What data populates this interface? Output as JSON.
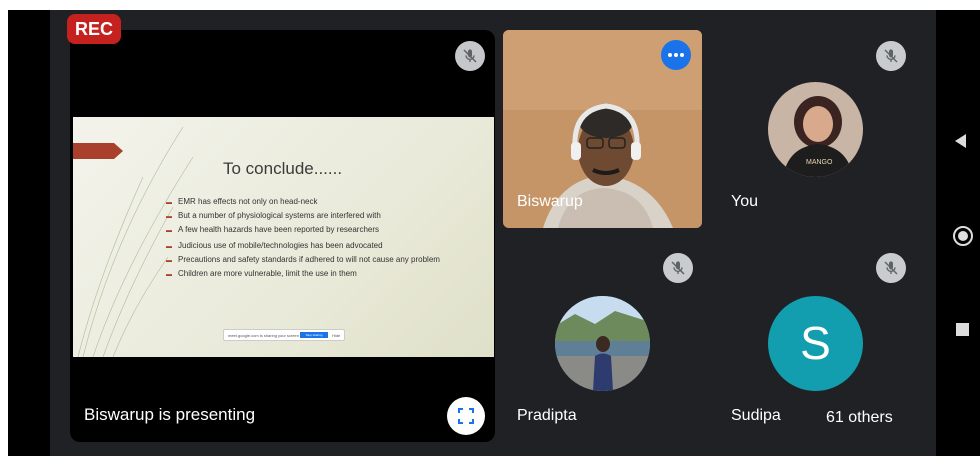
{
  "recording": {
    "label": "REC"
  },
  "presentation": {
    "presenter_label": "Biswarup is presenting",
    "slide": {
      "title": "To conclude......",
      "bullets": [
        "EMR has effects not only on head-neck",
        "But a number of physiological systems are interfered with",
        "A few health hazards have been reported by researchers",
        "Judicious use of mobile/technologies has been advocated",
        "Precautions and safety standards if adhered to will not cause any problem",
        "Children are more vulnerable, limit the use in them"
      ],
      "share_bar_text": "meet.google.com is sharing your screen",
      "share_bar_stop": "Stop sharing",
      "share_bar_hide": "Hide"
    }
  },
  "participants": {
    "biswarup": {
      "name": "Biswarup"
    },
    "you": {
      "name": "You"
    },
    "pradipta": {
      "name": "Pradipta"
    },
    "sudipa": {
      "name": "Sudipa",
      "initial": "S",
      "avatar_color": "#129eaf"
    },
    "others": {
      "label": "61 others"
    }
  },
  "colors": {
    "background": "#202124",
    "rec": "#c5221f",
    "speaking": "#1a73e8",
    "slide_accent": "#a8402c"
  },
  "icons": [
    "mic-off-icon",
    "fullscreen-icon",
    "speaking-indicator-icon",
    "nav-back-icon",
    "nav-home-icon",
    "nav-recents-icon"
  ]
}
